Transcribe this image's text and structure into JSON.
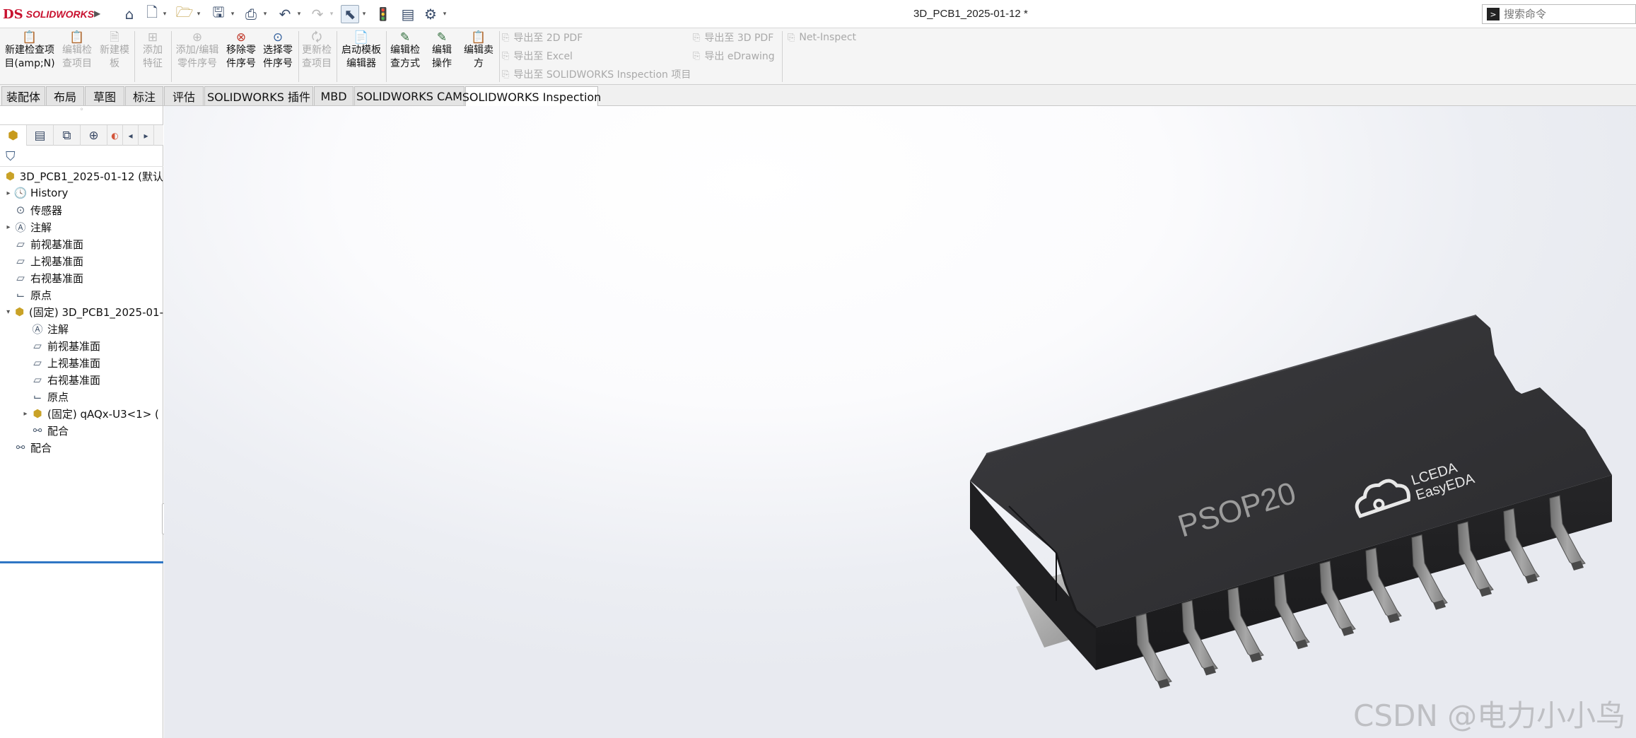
{
  "app": {
    "logo_mark": "DS",
    "logo_text": "SOLIDWORKS",
    "doc_title": "3D_PCB1_2025-01-12 *"
  },
  "search": {
    "placeholder": "搜索命令"
  },
  "quick_access": [
    "home-icon",
    "new-file-icon",
    "open-file-icon",
    "save-icon",
    "print-icon",
    "undo-icon",
    "redo-icon",
    "select-icon",
    "rebuild-icon",
    "file-properties-icon",
    "options-icon"
  ],
  "ribbon": {
    "new_inspection": "新建检查项目(amp;N)",
    "edit_inspection": "编辑检查项目",
    "new_template": "新建模板",
    "add_feature": "添加特征",
    "add_edit_balloon": "添加/编辑零件序号",
    "remove_balloon": "移除零件序号",
    "select_balloon": "选择零件序号",
    "update_inspection": "更新检查项目",
    "launch_template_editor": "启动模板编辑器",
    "edit_inspection_method": "编辑检查方式",
    "edit_operation": "编辑操作",
    "edit_vendor": "编辑卖方",
    "export_2d_pdf": "导出至 2D PDF",
    "export_excel": "导出至 Excel",
    "export_inspection_project": "导出至 SOLIDWORKS Inspection 项目",
    "export_3d_pdf": "导出至 3D PDF",
    "export_edrawing": "导出 eDrawing",
    "net_inspect": "Net-Inspect"
  },
  "tabs": [
    "装配体",
    "布局",
    "草图",
    "标注",
    "评估",
    "SOLIDWORKS 插件",
    "MBD",
    "SOLIDWORKS CAM",
    "SOLIDWORKS Inspection"
  ],
  "active_tab": "SOLIDWORKS Inspection",
  "tree": {
    "root": "3D_PCB1_2025-01-12  (默认",
    "history": "History",
    "sensors": "传感器",
    "annotations": "注解",
    "front_plane": "前视基准面",
    "top_plane": "上视基准面",
    "right_plane": "右视基准面",
    "origin": "原点",
    "sub_assembly": "(固定) 3D_PCB1_2025-01-",
    "sub_annotations": "注解",
    "sub_front_plane": "前视基准面",
    "sub_top_plane": "上视基准面",
    "sub_right_plane": "右视基准面",
    "sub_origin": "原点",
    "part": "(固定) qAQx-U3<1> (",
    "sub_mates": "配合",
    "mates": "配合"
  },
  "model": {
    "package_marking": "PSOP20",
    "brand_line1": "LCEDA",
    "brand_line2": "EasyEDA",
    "pin_count": 20,
    "body_color": "#2c2c2e",
    "pin_color": "#8d8d8d"
  },
  "watermark": "CSDN @电力小小鸟"
}
